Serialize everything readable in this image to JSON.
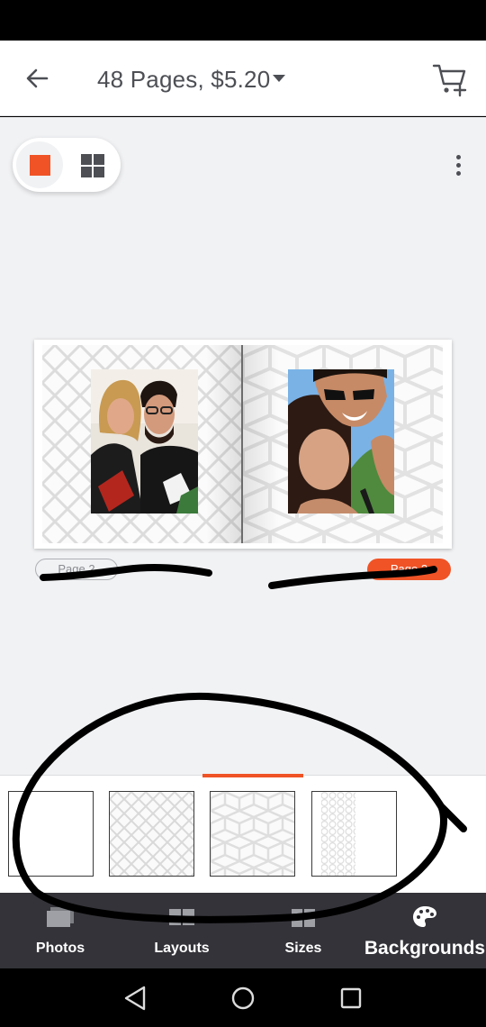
{
  "header": {
    "title": "48 Pages, $5.20"
  },
  "pages": {
    "left_label": "Page 2",
    "right_label": "Page 3"
  },
  "bottom_nav": {
    "items": [
      {
        "label": "Photos",
        "icon": "photos-icon"
      },
      {
        "label": "Layouts",
        "icon": "layouts-icon"
      },
      {
        "label": "Sizes",
        "icon": "sizes-icon"
      },
      {
        "label": "Backgrounds",
        "icon": "palette-icon"
      }
    ],
    "active_index": 3
  },
  "backgrounds": {
    "tiles": [
      "plain-white",
      "diamond-lattice",
      "hexagon-cubes",
      "honeycomb-strip"
    ],
    "selected_index": 2
  },
  "colors": {
    "accent": "#f05326",
    "nav_background": "#333339",
    "canvas_background": "#f1f2f4",
    "scribble": "#000000"
  }
}
